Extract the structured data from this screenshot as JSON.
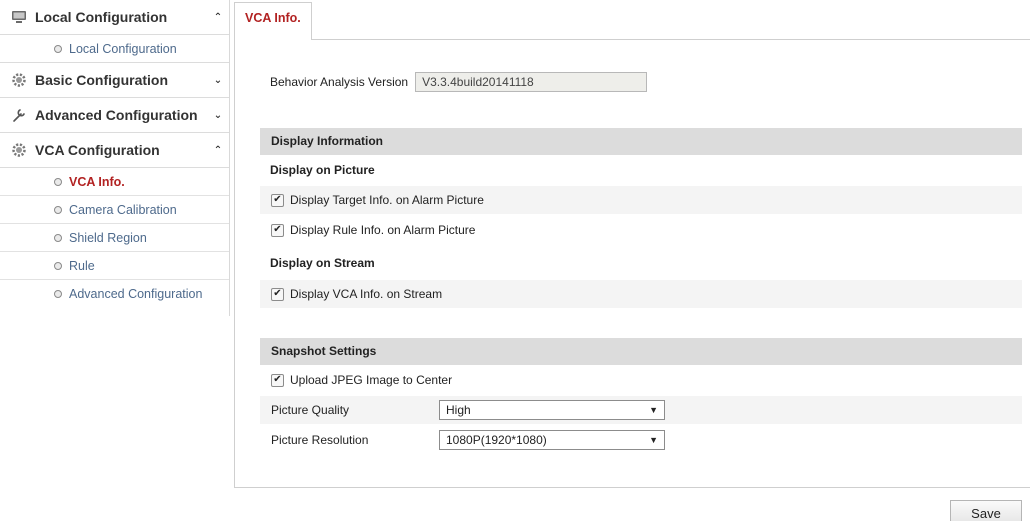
{
  "sidebar": {
    "groups": [
      {
        "label": "Local Configuration",
        "icon": "local-config-icon",
        "expanded": true,
        "items": [
          {
            "label": "Local Configuration",
            "active": false
          }
        ]
      },
      {
        "label": "Basic Configuration",
        "icon": "gear-icon",
        "expanded": false,
        "items": []
      },
      {
        "label": "Advanced Configuration",
        "icon": "wrench-icon",
        "expanded": false,
        "items": []
      },
      {
        "label": "VCA Configuration",
        "icon": "gear-icon",
        "expanded": true,
        "items": [
          {
            "label": "VCA Info.",
            "active": true
          },
          {
            "label": "Camera Calibration",
            "active": false
          },
          {
            "label": "Shield Region",
            "active": false
          },
          {
            "label": "Rule",
            "active": false
          },
          {
            "label": "Advanced Configuration",
            "active": false
          }
        ]
      }
    ]
  },
  "tab": {
    "label": "VCA Info."
  },
  "version": {
    "label": "Behavior Analysis Version",
    "value": "V3.3.4build20141118"
  },
  "display_info": {
    "title": "Display Information",
    "picture_heading": "Display on Picture",
    "target_info": {
      "label": "Display Target Info. on Alarm Picture",
      "checked": true
    },
    "rule_info": {
      "label": "Display Rule Info. on Alarm Picture",
      "checked": true
    },
    "stream_heading": "Display on Stream",
    "vca_stream": {
      "label": "Display VCA Info. on Stream",
      "checked": true
    }
  },
  "snapshot": {
    "title": "Snapshot Settings",
    "upload_jpeg": {
      "label": "Upload JPEG Image to Center",
      "checked": true
    },
    "quality": {
      "label": "Picture Quality",
      "value": "High"
    },
    "resolution": {
      "label": "Picture Resolution",
      "value": "1080P(1920*1080)"
    }
  },
  "save_label": "Save",
  "colors": {
    "active": "#b22222",
    "link": "#4e6a8c",
    "section_bg": "#dcdcdc"
  }
}
